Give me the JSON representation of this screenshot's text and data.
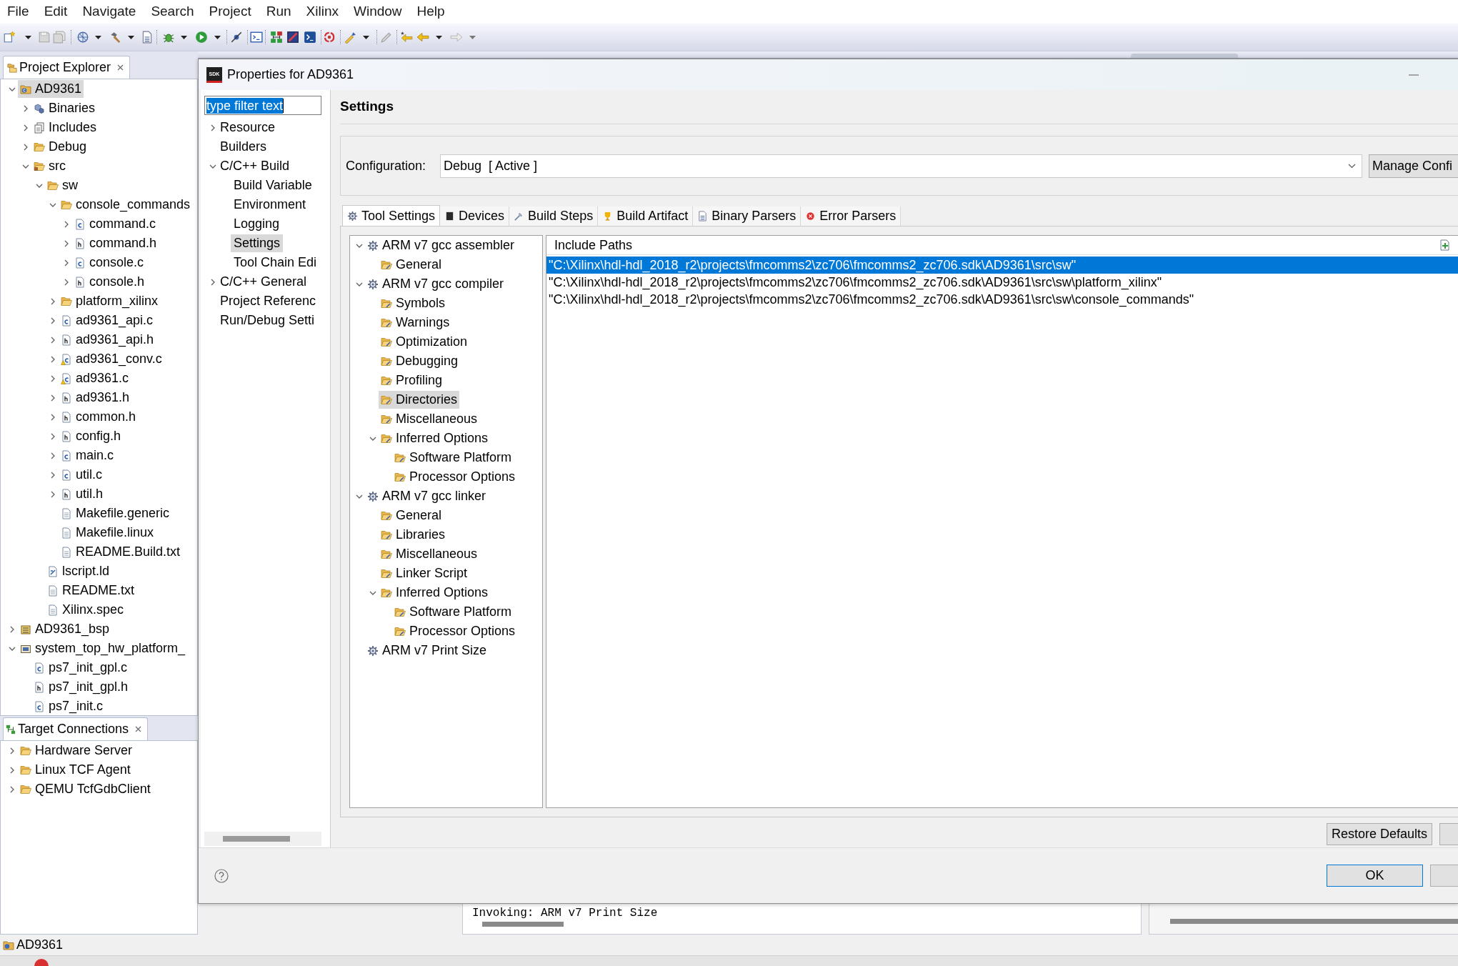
{
  "menu_bar": {
    "items": [
      "File",
      "Edit",
      "Navigate",
      "Search",
      "Project",
      "Run",
      "Xilinx",
      "Window",
      "Help"
    ]
  },
  "project_explorer": {
    "title": "Project Explorer",
    "items": [
      {
        "label": "AD9361",
        "kind": "project",
        "expanded": true,
        "selected": true,
        "children": [
          {
            "label": "Binaries",
            "kind": "binaries",
            "expanded": false,
            "selected": false
          },
          {
            "label": "Includes",
            "kind": "includes",
            "expanded": false,
            "selected": false
          },
          {
            "label": "Debug",
            "kind": "folder",
            "expanded": false,
            "selected": false
          },
          {
            "label": "src",
            "kind": "source-folder",
            "expanded": true,
            "selected": false,
            "children": [
              {
                "label": "sw",
                "kind": "folder",
                "expanded": true,
                "selected": false,
                "children": [
                  {
                    "label": "console_commands",
                    "kind": "folder",
                    "expanded": true,
                    "selected": false,
                    "children": [
                      {
                        "label": "command.c",
                        "kind": "c-file",
                        "expanded": false,
                        "selected": false
                      },
                      {
                        "label": "command.h",
                        "kind": "h-file",
                        "expanded": false,
                        "selected": false
                      },
                      {
                        "label": "console.c",
                        "kind": "c-file",
                        "expanded": false,
                        "selected": false
                      },
                      {
                        "label": "console.h",
                        "kind": "h-file",
                        "expanded": false,
                        "selected": false
                      }
                    ]
                  },
                  {
                    "label": "platform_xilinx",
                    "kind": "folder",
                    "expanded": false,
                    "selected": false
                  },
                  {
                    "label": "ad9361_api.c",
                    "kind": "c-file",
                    "expanded": false,
                    "selected": false
                  },
                  {
                    "label": "ad9361_api.h",
                    "kind": "h-file",
                    "expanded": false,
                    "selected": false
                  },
                  {
                    "label": "ad9361_conv.c",
                    "kind": "c-file-warning",
                    "expanded": false,
                    "selected": false
                  },
                  {
                    "label": "ad9361.c",
                    "kind": "c-file-warning",
                    "expanded": false,
                    "selected": false
                  },
                  {
                    "label": "ad9361.h",
                    "kind": "h-file",
                    "expanded": false,
                    "selected": false
                  },
                  {
                    "label": "common.h",
                    "kind": "h-file",
                    "expanded": false,
                    "selected": false
                  },
                  {
                    "label": "config.h",
                    "kind": "h-file",
                    "expanded": false,
                    "selected": false
                  },
                  {
                    "label": "main.c",
                    "kind": "c-file",
                    "expanded": false,
                    "selected": false
                  },
                  {
                    "label": "util.c",
                    "kind": "c-file",
                    "expanded": false,
                    "selected": false
                  },
                  {
                    "label": "util.h",
                    "kind": "h-file",
                    "expanded": false,
                    "selected": false
                  },
                  {
                    "label": "Makefile.generic",
                    "kind": "text-file",
                    "selected": false
                  },
                  {
                    "label": "Makefile.linux",
                    "kind": "text-file",
                    "selected": false
                  },
                  {
                    "label": "README.Build.txt",
                    "kind": "text-file",
                    "selected": false
                  }
                ]
              },
              {
                "label": "lscript.ld",
                "kind": "linker-script",
                "selected": false
              },
              {
                "label": "README.txt",
                "kind": "text-file",
                "selected": false
              },
              {
                "label": "Xilinx.spec",
                "kind": "text-file",
                "selected": false
              }
            ]
          }
        ]
      },
      {
        "label": "AD9361_bsp",
        "kind": "bsp-project",
        "expanded": false,
        "selected": false
      },
      {
        "label": "system_top_hw_platform_",
        "kind": "hw-project",
        "expanded": true,
        "selected": false,
        "children": [
          {
            "label": "ps7_init_gpl.c",
            "kind": "c-file",
            "selected": false
          },
          {
            "label": "ps7_init_gpl.h",
            "kind": "h-file",
            "selected": false
          },
          {
            "label": "ps7_init.c",
            "kind": "c-file",
            "selected": false
          }
        ]
      }
    ]
  },
  "target_connections": {
    "title": "Target Connections",
    "items": [
      {
        "label": "Hardware Server",
        "kind": "folder",
        "expanded": false,
        "selected": false
      },
      {
        "label": "Linux TCF Agent",
        "kind": "folder",
        "expanded": false,
        "selected": false
      },
      {
        "label": "QEMU TcfGdbClient",
        "kind": "folder",
        "expanded": false,
        "selected": false
      }
    ]
  },
  "console": {
    "text": "Invoking: ARM v7 Print Size"
  },
  "status_bar": {
    "text": "AD9361"
  },
  "dialog": {
    "logo": "SDK",
    "title": "Properties for AD9361",
    "filter": {
      "value": "type filter text",
      "text_selected": true
    },
    "nav": [
      {
        "label": "Resource",
        "expanded": false,
        "selected": false
      },
      {
        "label": "Builders",
        "selected": false
      },
      {
        "label": "C/C++ Build",
        "expanded": true,
        "selected": false,
        "children": [
          {
            "label": "Build Variable",
            "selected": false
          },
          {
            "label": "Environment",
            "selected": false
          },
          {
            "label": "Logging",
            "selected": false
          },
          {
            "label": "Settings",
            "selected": true
          },
          {
            "label": "Tool Chain Edi",
            "selected": false
          }
        ]
      },
      {
        "label": "C/C++ General",
        "expanded": false,
        "selected": false
      },
      {
        "label": "Project Referenc",
        "selected": false
      },
      {
        "label": "Run/Debug Setti",
        "selected": false
      }
    ],
    "page_title": "Settings",
    "configuration": {
      "label": "Configuration:",
      "value": "Debug  [ Active ]",
      "button": "Manage Confi"
    },
    "tabs": [
      {
        "label": "Tool Settings",
        "selected": true
      },
      {
        "label": "Devices",
        "selected": false
      },
      {
        "label": "Build Steps",
        "selected": false
      },
      {
        "label": "Build Artifact",
        "selected": false
      },
      {
        "label": "Binary Parsers",
        "selected": false
      },
      {
        "label": "Error Parsers",
        "selected": false
      }
    ],
    "tool_tree": [
      {
        "label": "ARM v7 gcc assembler",
        "kind": "tool",
        "expanded": true,
        "selected": false,
        "children": [
          {
            "label": "General",
            "kind": "option",
            "selected": false
          }
        ]
      },
      {
        "label": "ARM v7 gcc compiler",
        "kind": "tool",
        "expanded": true,
        "selected": false,
        "children": [
          {
            "label": "Symbols",
            "kind": "option",
            "selected": false
          },
          {
            "label": "Warnings",
            "kind": "option",
            "selected": false
          },
          {
            "label": "Optimization",
            "kind": "option",
            "selected": false
          },
          {
            "label": "Debugging",
            "kind": "option",
            "selected": false
          },
          {
            "label": "Profiling",
            "kind": "option",
            "selected": false
          },
          {
            "label": "Directories",
            "kind": "option",
            "selected": true
          },
          {
            "label": "Miscellaneous",
            "kind": "option",
            "selected": false
          },
          {
            "label": "Inferred Options",
            "kind": "option",
            "expanded": true,
            "selected": false,
            "children": [
              {
                "label": "Software Platform",
                "kind": "option",
                "selected": false
              },
              {
                "label": "Processor Options",
                "kind": "option",
                "selected": false
              }
            ]
          }
        ]
      },
      {
        "label": "ARM v7 gcc linker",
        "kind": "tool",
        "expanded": true,
        "selected": false,
        "children": [
          {
            "label": "General",
            "kind": "option",
            "selected": false
          },
          {
            "label": "Libraries",
            "kind": "option",
            "selected": false
          },
          {
            "label": "Miscellaneous",
            "kind": "option",
            "selected": false
          },
          {
            "label": "Linker Script",
            "kind": "option",
            "selected": false
          },
          {
            "label": "Inferred Options",
            "kind": "option",
            "expanded": true,
            "selected": false,
            "children": [
              {
                "label": "Software Platform",
                "kind": "option",
                "selected": false
              },
              {
                "label": "Processor Options",
                "kind": "option",
                "selected": false
              }
            ]
          }
        ]
      },
      {
        "label": "ARM v7 Print Size",
        "kind": "tool",
        "selected": false
      }
    ],
    "include_paths": {
      "title": "Include Paths",
      "rows": [
        {
          "path": "\"C:\\Xilinx\\hdl-hdl_2018_r2\\projects\\fmcomms2\\zc706\\fmcomms2_zc706.sdk\\AD9361\\src\\sw\"",
          "selected": true
        },
        {
          "path": "\"C:\\Xilinx\\hdl-hdl_2018_r2\\projects\\fmcomms2\\zc706\\fmcomms2_zc706.sdk\\AD9361\\src\\sw\\platform_xilinx\"",
          "selected": false
        },
        {
          "path": "\"C:\\Xilinx\\hdl-hdl_2018_r2\\projects\\fmcomms2\\zc706\\fmcomms2_zc706.sdk\\AD9361\\src\\sw\\console_commands\"",
          "selected": false
        }
      ]
    },
    "restore_button": "Restore Defaults",
    "ok_button": {
      "label": "OK",
      "default": true
    }
  }
}
